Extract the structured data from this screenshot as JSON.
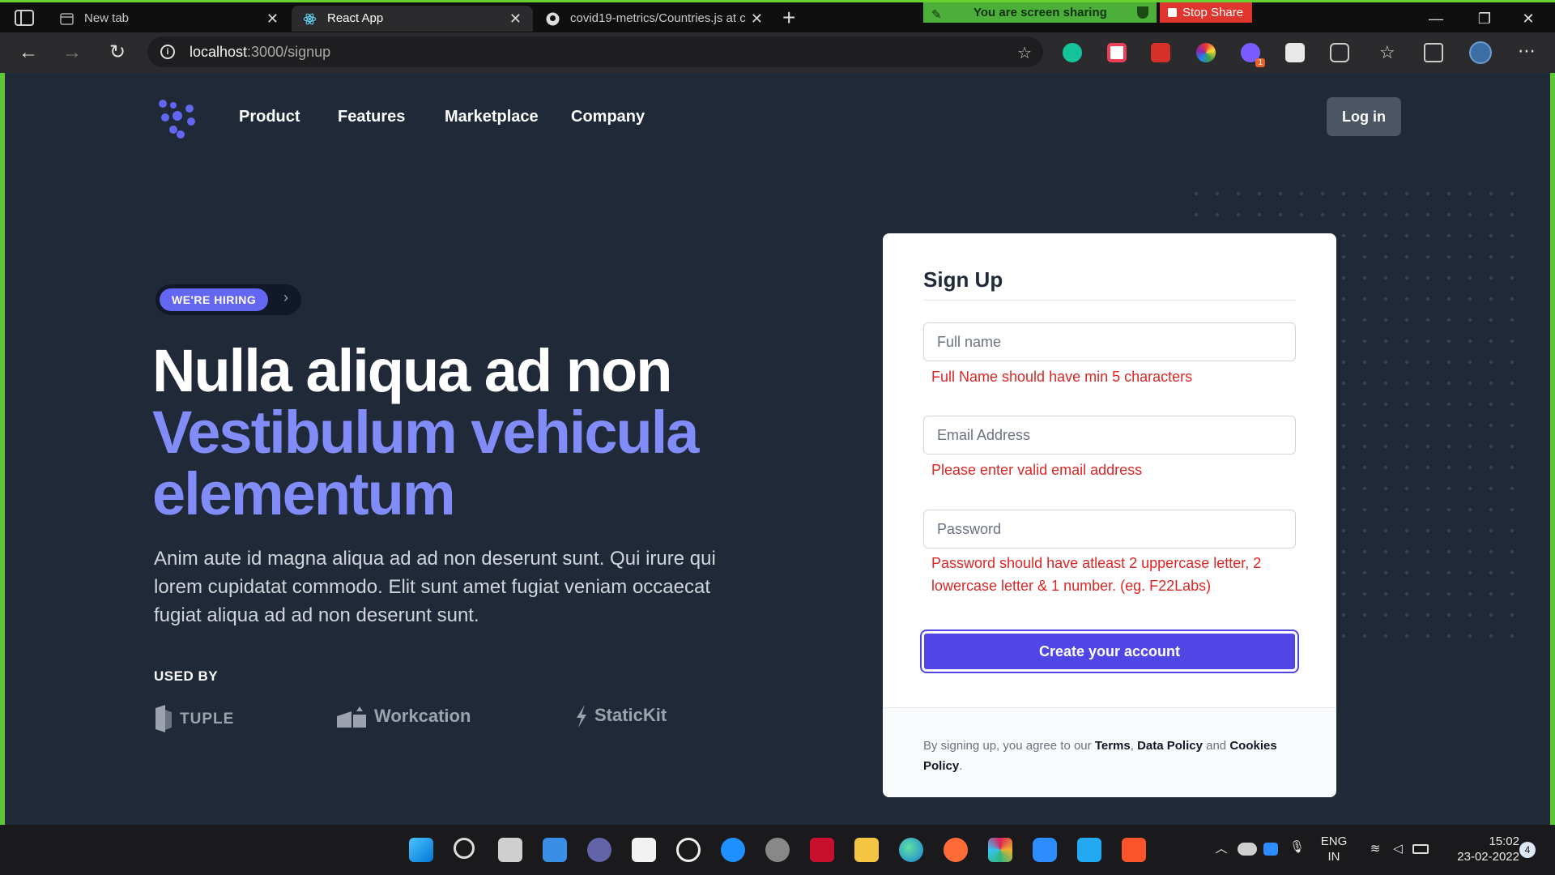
{
  "browser": {
    "tabs": [
      {
        "title": "New tab",
        "active": false
      },
      {
        "title": "React App",
        "active": true
      },
      {
        "title": "covid19-metrics/Countries.js at c",
        "active": false
      }
    ],
    "share_banner": "You are screen sharing",
    "stop_share": "Stop Share",
    "url_host": "localhost",
    "url_path": ":3000/signup",
    "icons": [
      "back-icon",
      "forward-icon",
      "refresh-icon",
      "info-icon",
      "favorite-add-icon",
      "grammarly-icon",
      "pocket-icon",
      "extension-icon",
      "color-picker-icon",
      "extension-badge-icon",
      "puzzle-icon",
      "favorites-icon",
      "collections-icon",
      "profile-avatar",
      "more-icon"
    ],
    "ext_badge_count": "1"
  },
  "nav": {
    "items": [
      "Product",
      "Features",
      "Marketplace",
      "Company"
    ],
    "login": "Log in"
  },
  "hero": {
    "badge": "WE'RE HIRING",
    "title_line1": "Nulla aliqua ad non",
    "title_line2": "Vestibulum vehicula",
    "title_line3": "elementum",
    "description": "Anim aute id magna aliqua ad ad non deserunt sunt. Qui irure qui lorem cupidatat commodo. Elit sunt amet fugiat veniam occaecat fugiat aliqua ad ad non deserunt sunt.",
    "used_by": "USED BY",
    "brands": [
      "TUPLE",
      "Workcation",
      "StaticKit"
    ]
  },
  "form": {
    "title": "Sign Up",
    "fullname_placeholder": "Full name",
    "fullname_error": "Full Name should have min 5 characters",
    "email_placeholder": "Email Address",
    "email_error": "Please enter valid email address",
    "password_placeholder": "Password",
    "password_error": "Password should have atleast 2 uppercase letter, 2 lowercase letter & 1 number. (eg. F22Labs)",
    "submit": "Create your account",
    "footer_prefix": "By signing up, you agree to our ",
    "terms": "Terms",
    "sep1": ", ",
    "data_policy": "Data Policy",
    "sep2": " and ",
    "cookies_policy": "Cookies Policy",
    "footer_suffix": "."
  },
  "taskbar": {
    "lang_line1": "ENG",
    "lang_line2": "IN",
    "time": "15:02",
    "date": "23-02-2022",
    "notif_count": "4"
  },
  "colors": {
    "page_bg": "#1f2937",
    "accent": "#6366f1",
    "accent_light": "#818cf8",
    "button": "#4f46e5",
    "error": "#dc2626",
    "share_green": "#4caf39",
    "stop_red": "#e0352e"
  }
}
